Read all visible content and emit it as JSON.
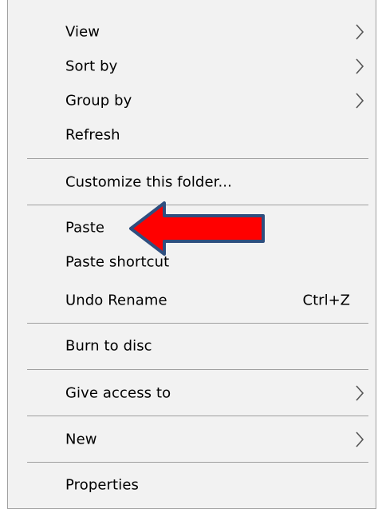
{
  "context_menu": {
    "items": {
      "view": {
        "label": "View",
        "icon": "chevron-right-icon"
      },
      "sort_by": {
        "label": "Sort by",
        "icon": "chevron-right-icon"
      },
      "group_by": {
        "label": "Group by",
        "icon": "chevron-right-icon"
      },
      "refresh": {
        "label": "Refresh"
      },
      "customize": {
        "label": "Customize this folder..."
      },
      "paste": {
        "label": "Paste"
      },
      "paste_shortcut": {
        "label": "Paste shortcut"
      },
      "undo_rename": {
        "label": "Undo Rename",
        "shortcut": "Ctrl+Z"
      },
      "burn": {
        "label": "Burn to disc"
      },
      "give_access": {
        "label": "Give access to",
        "icon": "chevron-right-icon"
      },
      "new": {
        "label": "New",
        "icon": "chevron-right-icon"
      },
      "properties": {
        "label": "Properties"
      }
    }
  },
  "annotation": {
    "icon": "left-arrow-icon",
    "fill_color": "#ff0000",
    "stroke_color": "#2f4f7f"
  },
  "colors": {
    "menu_background": "#f2f2f2",
    "separator": "#a0a0a0",
    "text": "#000000"
  }
}
